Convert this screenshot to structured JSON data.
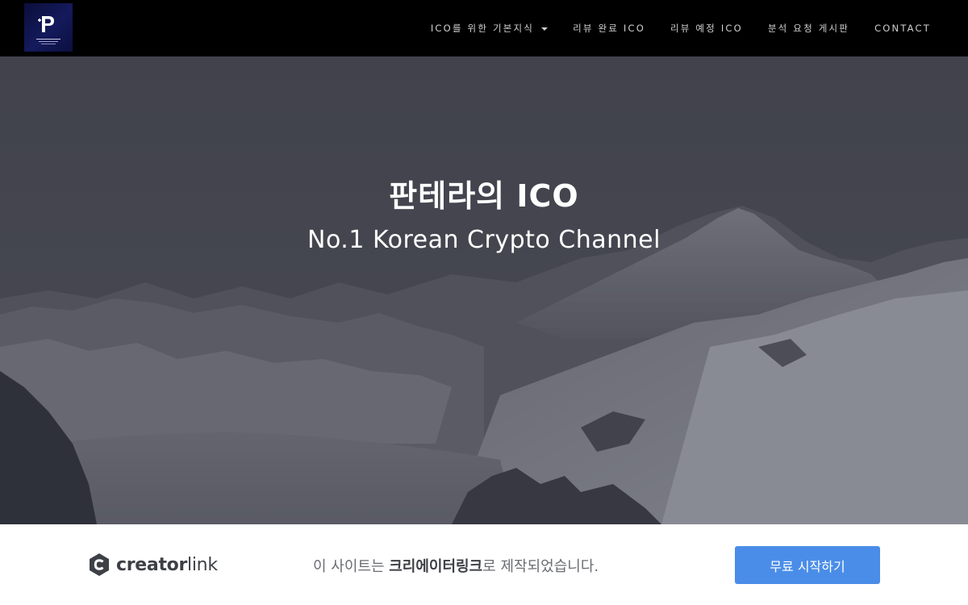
{
  "nav": {
    "logo_icon": "pantera-logo",
    "items": [
      {
        "label": "ICO를 위한 기본지식",
        "has_dropdown": true
      },
      {
        "label": "리뷰 완료 ICO"
      },
      {
        "label": "리뷰 예정 ICO"
      },
      {
        "label": "분석 요청 게시판"
      },
      {
        "label": "CONTACT"
      }
    ]
  },
  "hero": {
    "title": "판테라의 ICO",
    "subtitle": "No.1 Korean Crypto Channel",
    "background": "snowy-mountains-image"
  },
  "banner": {
    "brand_bold": "creator",
    "brand_light": "link",
    "message_before": "이 사이트는 ",
    "message_strong": "크리에이터링크",
    "message_after": "로 제작되었습니다.",
    "cta_label": "무료 시작하기"
  },
  "colors": {
    "nav_bg": "#000000",
    "cta_bg": "#4a8de8",
    "brand_text": "#3d4045"
  }
}
